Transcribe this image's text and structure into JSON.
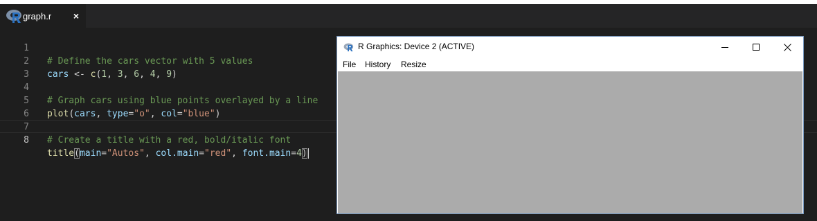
{
  "editor_tab": {
    "title": "graph.r",
    "close": "×"
  },
  "editor": {
    "lines": [
      {
        "num": "1",
        "text": "# Define the cars vector with 5 values"
      },
      {
        "num": "2",
        "text": "cars <- c(1, 3, 6, 4, 9)"
      },
      {
        "num": "3",
        "text": ""
      },
      {
        "num": "4",
        "text": "# Graph cars using blue points overlayed by a line"
      },
      {
        "num": "5",
        "text": "plot(cars, type=\"o\", col=\"blue\")"
      },
      {
        "num": "6",
        "text": ""
      },
      {
        "num": "7",
        "text": "# Create a title with a red, bold/italic font"
      },
      {
        "num": "8",
        "text": "title(main=\"Autos\", col.main=\"red\", font.main=4)"
      }
    ],
    "active_line": "8"
  },
  "r_window": {
    "title": "R Graphics: Device 2 (ACTIVE)",
    "menu": [
      "File",
      "History",
      "Resize"
    ]
  },
  "colors": {
    "editor_background": "#1e1e1e",
    "comment": "#6a9955",
    "string": "#ce9178",
    "number": "#b5cea8",
    "function": "#dcdcaa",
    "variable": "#9cdcfe",
    "graphics_canvas": "#ababab"
  },
  "icons": {
    "tab_icon": "r-logo-icon",
    "window_icon": "r-logo-icon",
    "window_controls": [
      "minimize-icon",
      "maximize-icon",
      "close-icon"
    ]
  }
}
